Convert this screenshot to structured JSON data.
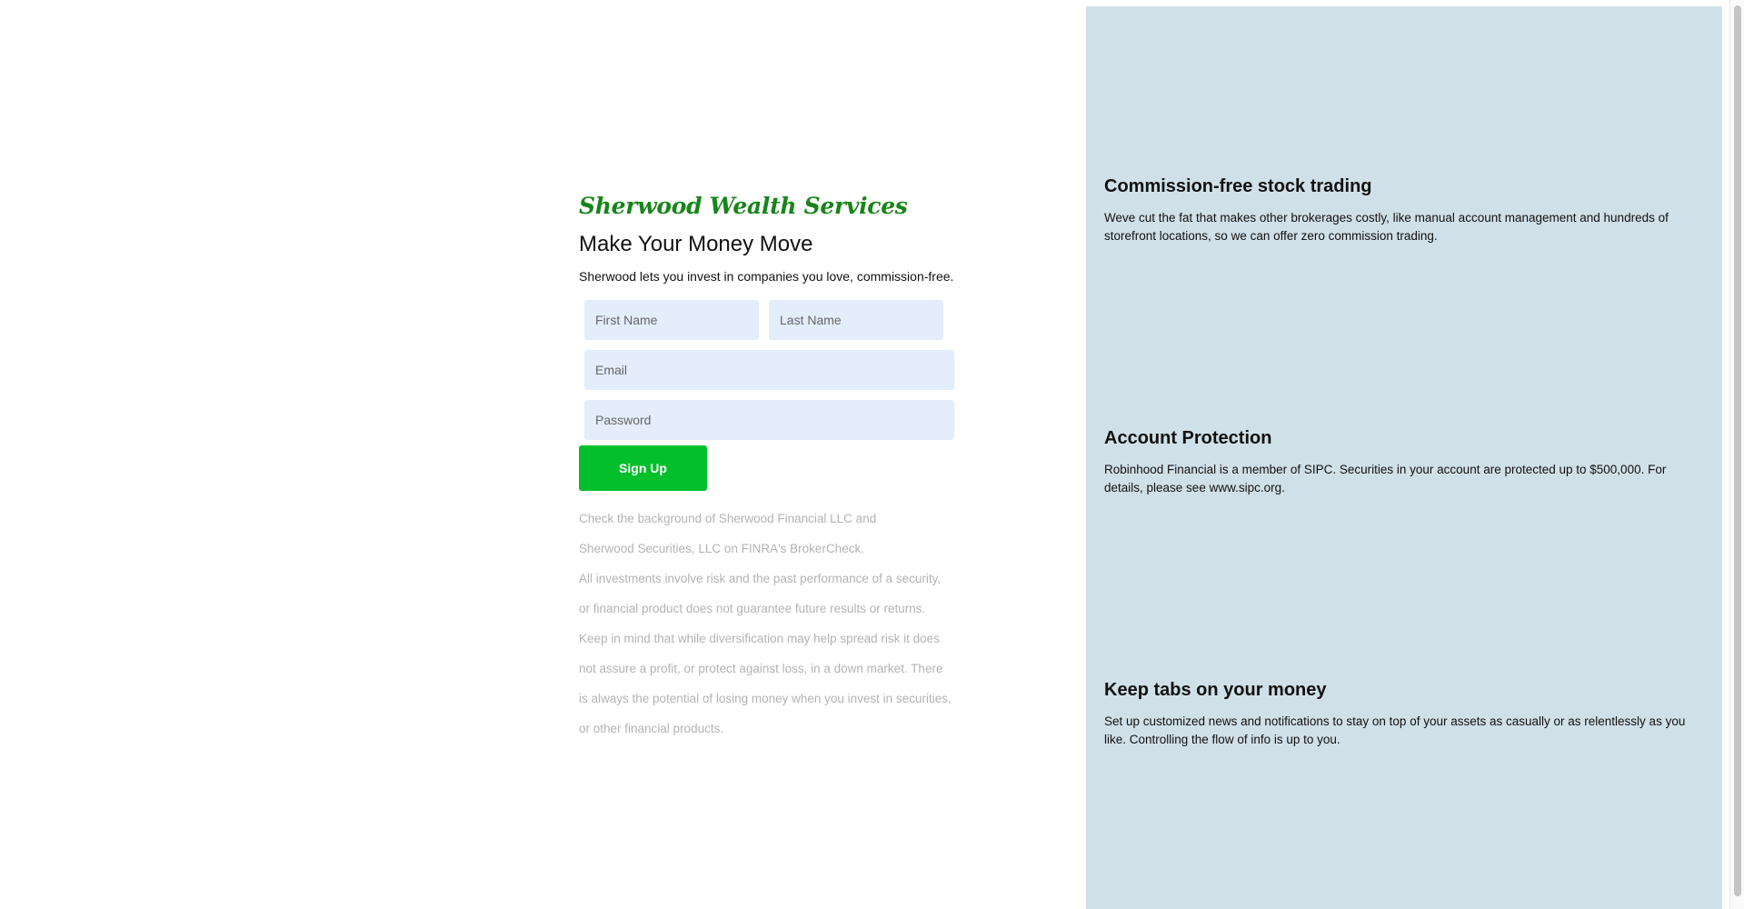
{
  "brand": {
    "name": "Sherwood Wealth Services",
    "color": "#18851a"
  },
  "hero": {
    "headline": "Make Your Money Move",
    "subline": "Sherwood lets you invest in companies you love, commission-free."
  },
  "form": {
    "first_name_placeholder": "First Name",
    "last_name_placeholder": "Last Name",
    "email_placeholder": "Email",
    "password_placeholder": "Password",
    "submit_label": "Sign Up",
    "submit_color": "#04bf2c",
    "field_background": "#e3edfb"
  },
  "disclaimer": {
    "lines": [
      "Check the background of Sherwood Financial LLC and",
      "Sherwood Securities, LLC on FINRA's BrokerCheck.",
      "All investments involve risk and the past performance of a security,",
      "or financial product does not guarantee future results or returns.",
      "Keep in mind that while diversification may help spread risk it does",
      "not assure a profit, or protect against loss, in a down market. There",
      "is always the potential of losing money when you invest in securities,",
      "or other financial products."
    ]
  },
  "features": {
    "background": "#d0e0e8",
    "items": [
      {
        "title": "Commission-free stock trading",
        "body": "Weve cut the fat that makes other brokerages costly, like manual account management and hundreds of storefront locations, so we can offer zero commission trading."
      },
      {
        "title": "Account Protection",
        "body": "Robinhood Financial is a member of SIPC. Securities in your account are protected up to $500,000. For details, please see www.sipc.org."
      },
      {
        "title": "Keep tabs on your money",
        "body": "Set up customized news and notifications to stay on top of your assets as casually or as relentlessly as you like. Controlling the flow of info is up to you."
      }
    ]
  }
}
